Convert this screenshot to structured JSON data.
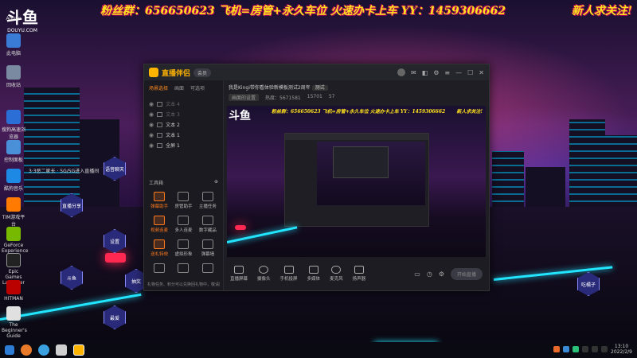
{
  "banner": {
    "left": "粉丝群：656650623 飞机=房管+永久车位 火速办卡上车 YY：1459306662",
    "right": "新人求关注!"
  },
  "desktop": {
    "logo": "斗鱼",
    "logo_sub": "DOUYU.COM",
    "icons": [
      {
        "label": "Admin"
      },
      {
        "label": "此电脑"
      },
      {
        "label": "回收站"
      },
      {
        "label": "搜狗高速浏览器"
      },
      {
        "label": "控制面板"
      },
      {
        "label": "酷狗音乐"
      },
      {
        "label": "TIM游戏平台"
      },
      {
        "label": "GeForce Experience"
      },
      {
        "label": "Epic Games Launcher"
      },
      {
        "label": "HITMAN"
      },
      {
        "label": "The Beginner's Guide"
      }
    ],
    "scroll_text": "3·3恶二家长 · 5G/5G进入直播间",
    "hexes": [
      "语音聊天",
      "直播分享",
      "设置",
      "斗鱼",
      "抽奖",
      "最爱",
      "吃橘子"
    ]
  },
  "app": {
    "name": "直播伴侣",
    "badge": "会员",
    "left_tabs": [
      "场景选择",
      "画面",
      "可选项"
    ],
    "scenes": [
      {
        "label": "文本 4",
        "dim": true
      },
      {
        "label": "文本 3",
        "dim": true
      },
      {
        "label": "文本 2",
        "dim": false
      },
      {
        "label": "文本 1",
        "dim": false
      },
      {
        "label": "全屏 1",
        "dim": false
      }
    ],
    "tools_title": "工具箱",
    "tools": [
      {
        "label": "弹幕助手",
        "on": true
      },
      {
        "label": "房管助手",
        "on": false
      },
      {
        "label": "主播任务",
        "on": false
      },
      {
        "label": "视频连麦",
        "on": true
      },
      {
        "label": "多人连麦",
        "on": false
      },
      {
        "label": "数字藏品",
        "on": false
      },
      {
        "label": "送礼特效",
        "on": true
      },
      {
        "label": "虚拟形象",
        "on": false
      },
      {
        "label": "弹幕墙",
        "on": false
      },
      {
        "label": "",
        "on": false
      },
      {
        "label": "",
        "on": false
      },
      {
        "label": "",
        "on": false
      }
    ],
    "notice": "礼物任务、积分可以兑换回礼物中，敬请期待",
    "room_title": "我是Kingi带你看体验新模板测试2周年",
    "room_tag": "测试",
    "room_category": "画面的设置",
    "room_stats": [
      "热度：5671581",
      "15701",
      "57"
    ],
    "bottom_tools": [
      "直播屏幕",
      "摄像头",
      "手机投屏",
      "多媒体",
      "麦克风",
      "扬声器"
    ],
    "start_live": "开始直播"
  },
  "taskbar": {
    "time": "13:10",
    "date": "2022/2/9"
  }
}
